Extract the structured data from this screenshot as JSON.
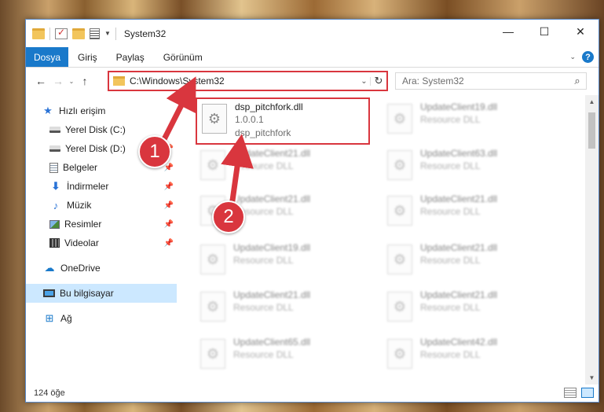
{
  "window": {
    "title": "System32",
    "controls": {
      "minimize": "—",
      "maximize": "☐",
      "close": "✕"
    }
  },
  "ribbon": {
    "file_tab": "Dosya",
    "tabs": [
      "Giriş",
      "Paylaş",
      "Görünüm"
    ],
    "help": "?"
  },
  "nav": {
    "back": "←",
    "forward": "→",
    "up": "↑",
    "address": "C:\\Windows\\System32",
    "refresh": "↻",
    "search_placeholder": "Ara: System32"
  },
  "sidebar": {
    "quick_access": "Hızlı erişim",
    "items": [
      {
        "label": "Yerel Disk (C:)",
        "icon": "drive-icon"
      },
      {
        "label": "Yerel Disk (D:)",
        "icon": "drive-icon"
      },
      {
        "label": "Belgeler",
        "icon": "documents-icon"
      },
      {
        "label": "İndirmeler",
        "icon": "downloads-icon"
      },
      {
        "label": "Müzik",
        "icon": "music-icon"
      },
      {
        "label": "Resimler",
        "icon": "pictures-icon"
      },
      {
        "label": "Videolar",
        "icon": "videos-icon"
      }
    ],
    "onedrive": "OneDrive",
    "this_pc": "Bu bilgisayar",
    "network": "Ağ"
  },
  "files": [
    {
      "name": "dsp_pitchfork.dll",
      "line2": "1.0.0.1",
      "line3": "dsp_pitchfork",
      "highlight": true
    },
    {
      "name": "UpdateClient19.dll",
      "line2": "Resource DLL"
    },
    {
      "name": "UpdateClient21.dll",
      "line2": "Resource DLL"
    },
    {
      "name": "UpdateClient63.dll",
      "line2": "Resource DLL"
    },
    {
      "name": "UpdateClient21.dll",
      "line2": "Resource DLL"
    },
    {
      "name": "UpdateClient21.dll",
      "line2": "Resource DLL"
    },
    {
      "name": "UpdateClient19.dll",
      "line2": "Resource DLL"
    },
    {
      "name": "UpdateClient21.dll",
      "line2": "Resource DLL"
    },
    {
      "name": "UpdateClient21.dll",
      "line2": "Resource DLL"
    },
    {
      "name": "UpdateClient21.dll",
      "line2": "Resource DLL"
    },
    {
      "name": "UpdateClient65.dll",
      "line2": "Resource DLL"
    },
    {
      "name": "UpdateClient42.dll",
      "line2": "Resource DLL"
    }
  ],
  "status": {
    "count": "124 öğe"
  },
  "callouts": [
    "1",
    "2"
  ],
  "colors": {
    "accent": "#1979ca",
    "highlight": "#d9363e",
    "selected": "#cce8ff"
  }
}
